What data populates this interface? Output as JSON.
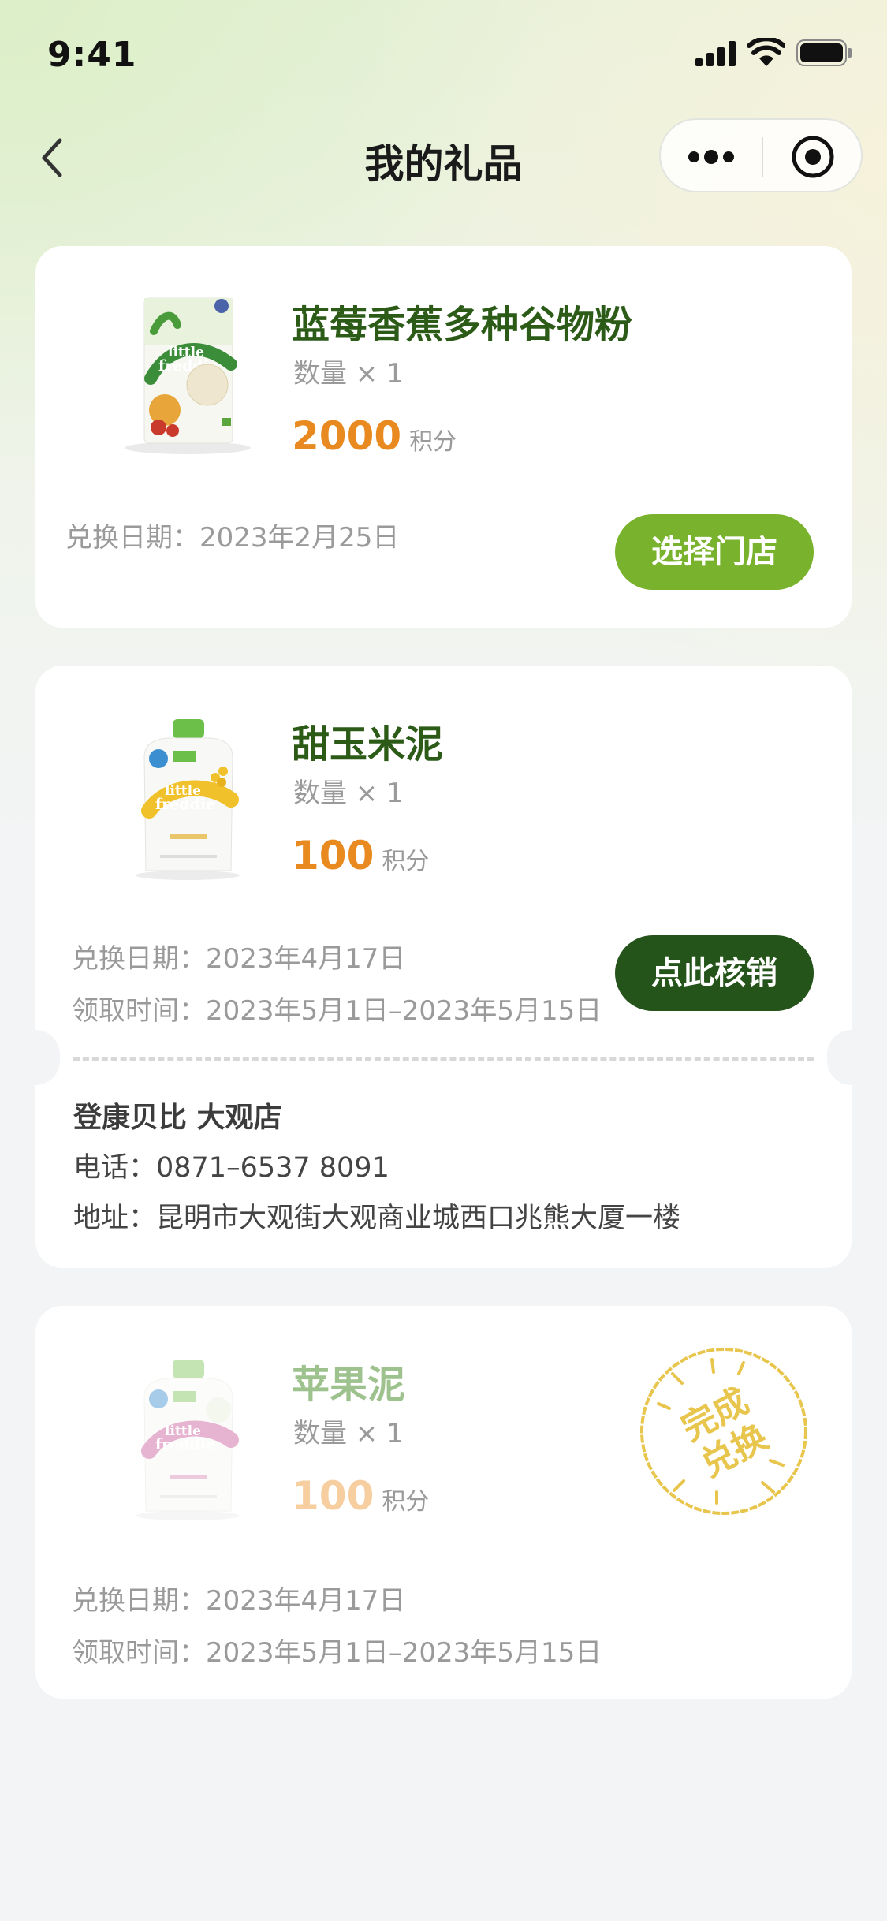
{
  "status_bar": {
    "time": "9:41"
  },
  "nav": {
    "title": "我的礼品"
  },
  "gifts": [
    {
      "name": "蓝莓香蕉多种谷物粉",
      "quantity": "数量 × 1",
      "points": "2000",
      "points_unit": "积分",
      "redeem_date": "兑换日期：2023年2月25日",
      "button": "选择门店",
      "image_brand": "little freddie",
      "image_colors": {
        "accent": "#3b8d3a",
        "fruit": "#e8a63a"
      }
    },
    {
      "name": "甜玉米泥",
      "quantity": "数量 × 1",
      "points": "100",
      "points_unit": "积分",
      "redeem_date": "兑换日期：2023年4月17日",
      "pickup_time": "领取时间：2023年5月1日–2023年5月15日",
      "button": "点此核销",
      "store": {
        "name": "登康贝比 大观店",
        "phone": "电话：0871–6537 8091",
        "address": "地址：昆明市大观街大观商业城西口兆熊大厦一楼"
      },
      "image_brand": "little freddie",
      "image_colors": {
        "cap": "#6cc04a",
        "swirl": "#f0c12b"
      }
    },
    {
      "name": "苹果泥",
      "quantity": "数量 × 1",
      "points": "100",
      "points_unit": "积分",
      "redeem_date": "兑换日期：2023年4月17日",
      "pickup_time": "领取时间：2023年5月1日–2023年5月15日",
      "stamp": {
        "line1": "完成",
        "line2": "兑换"
      },
      "image_brand": "little freddie",
      "image_colors": {
        "cap": "#7cc45a",
        "swirl": "#c9589b"
      }
    }
  ],
  "colors": {
    "primary_green": "#79b22c",
    "dark_green": "#24541a",
    "title_green": "#2c5b18",
    "points_orange": "#e88a1f",
    "stamp_gold": "#e8c54c"
  }
}
